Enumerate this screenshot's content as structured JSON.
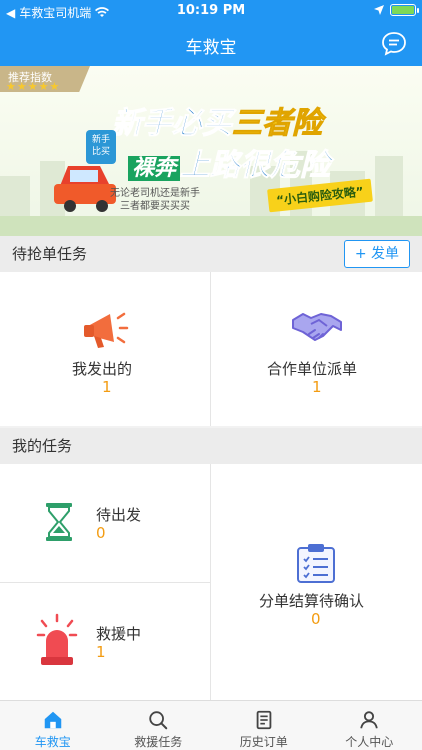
{
  "status": {
    "carrier": "车救宝司机端",
    "time": "10:19 PM"
  },
  "nav": {
    "title": "车救宝",
    "message_icon": "message-icon"
  },
  "banner": {
    "ribbon": "推荐指数",
    "stars": "★★★★★",
    "headline1_a": "新手必买",
    "headline1_b": "三者险",
    "headline2_a": "裸奔",
    "headline2_b": "上路很危险",
    "badge": "新手\n比买",
    "sub1": "无论老司机还是新手",
    "sub2": "三者都要买买买",
    "tag": "“小白购险攻略”"
  },
  "pending": {
    "title": "待抢单任务",
    "post_button": "+ 发单",
    "items": [
      {
        "label": "我发出的",
        "count": "1",
        "icon": "megaphone-icon"
      },
      {
        "label": "合作单位派单",
        "count": "1",
        "icon": "handshake-icon"
      }
    ]
  },
  "mine": {
    "title": "我的任务",
    "items": [
      {
        "label": "待出发",
        "count": "0",
        "icon": "hourglass-icon"
      },
      {
        "label": "救援中",
        "count": "1",
        "icon": "siren-icon"
      },
      {
        "label": "分单结算待确认",
        "count": "0",
        "icon": "clipboard-icon"
      }
    ]
  },
  "tabs": [
    {
      "label": "车救宝",
      "icon": "home-icon",
      "active": true
    },
    {
      "label": "救援任务",
      "icon": "search-icon",
      "active": false
    },
    {
      "label": "历史订单",
      "icon": "document-icon",
      "active": false
    },
    {
      "label": "个人中心",
      "icon": "person-icon",
      "active": false
    }
  ],
  "colors": {
    "primary": "#2196f3",
    "accent": "#f39c12"
  }
}
